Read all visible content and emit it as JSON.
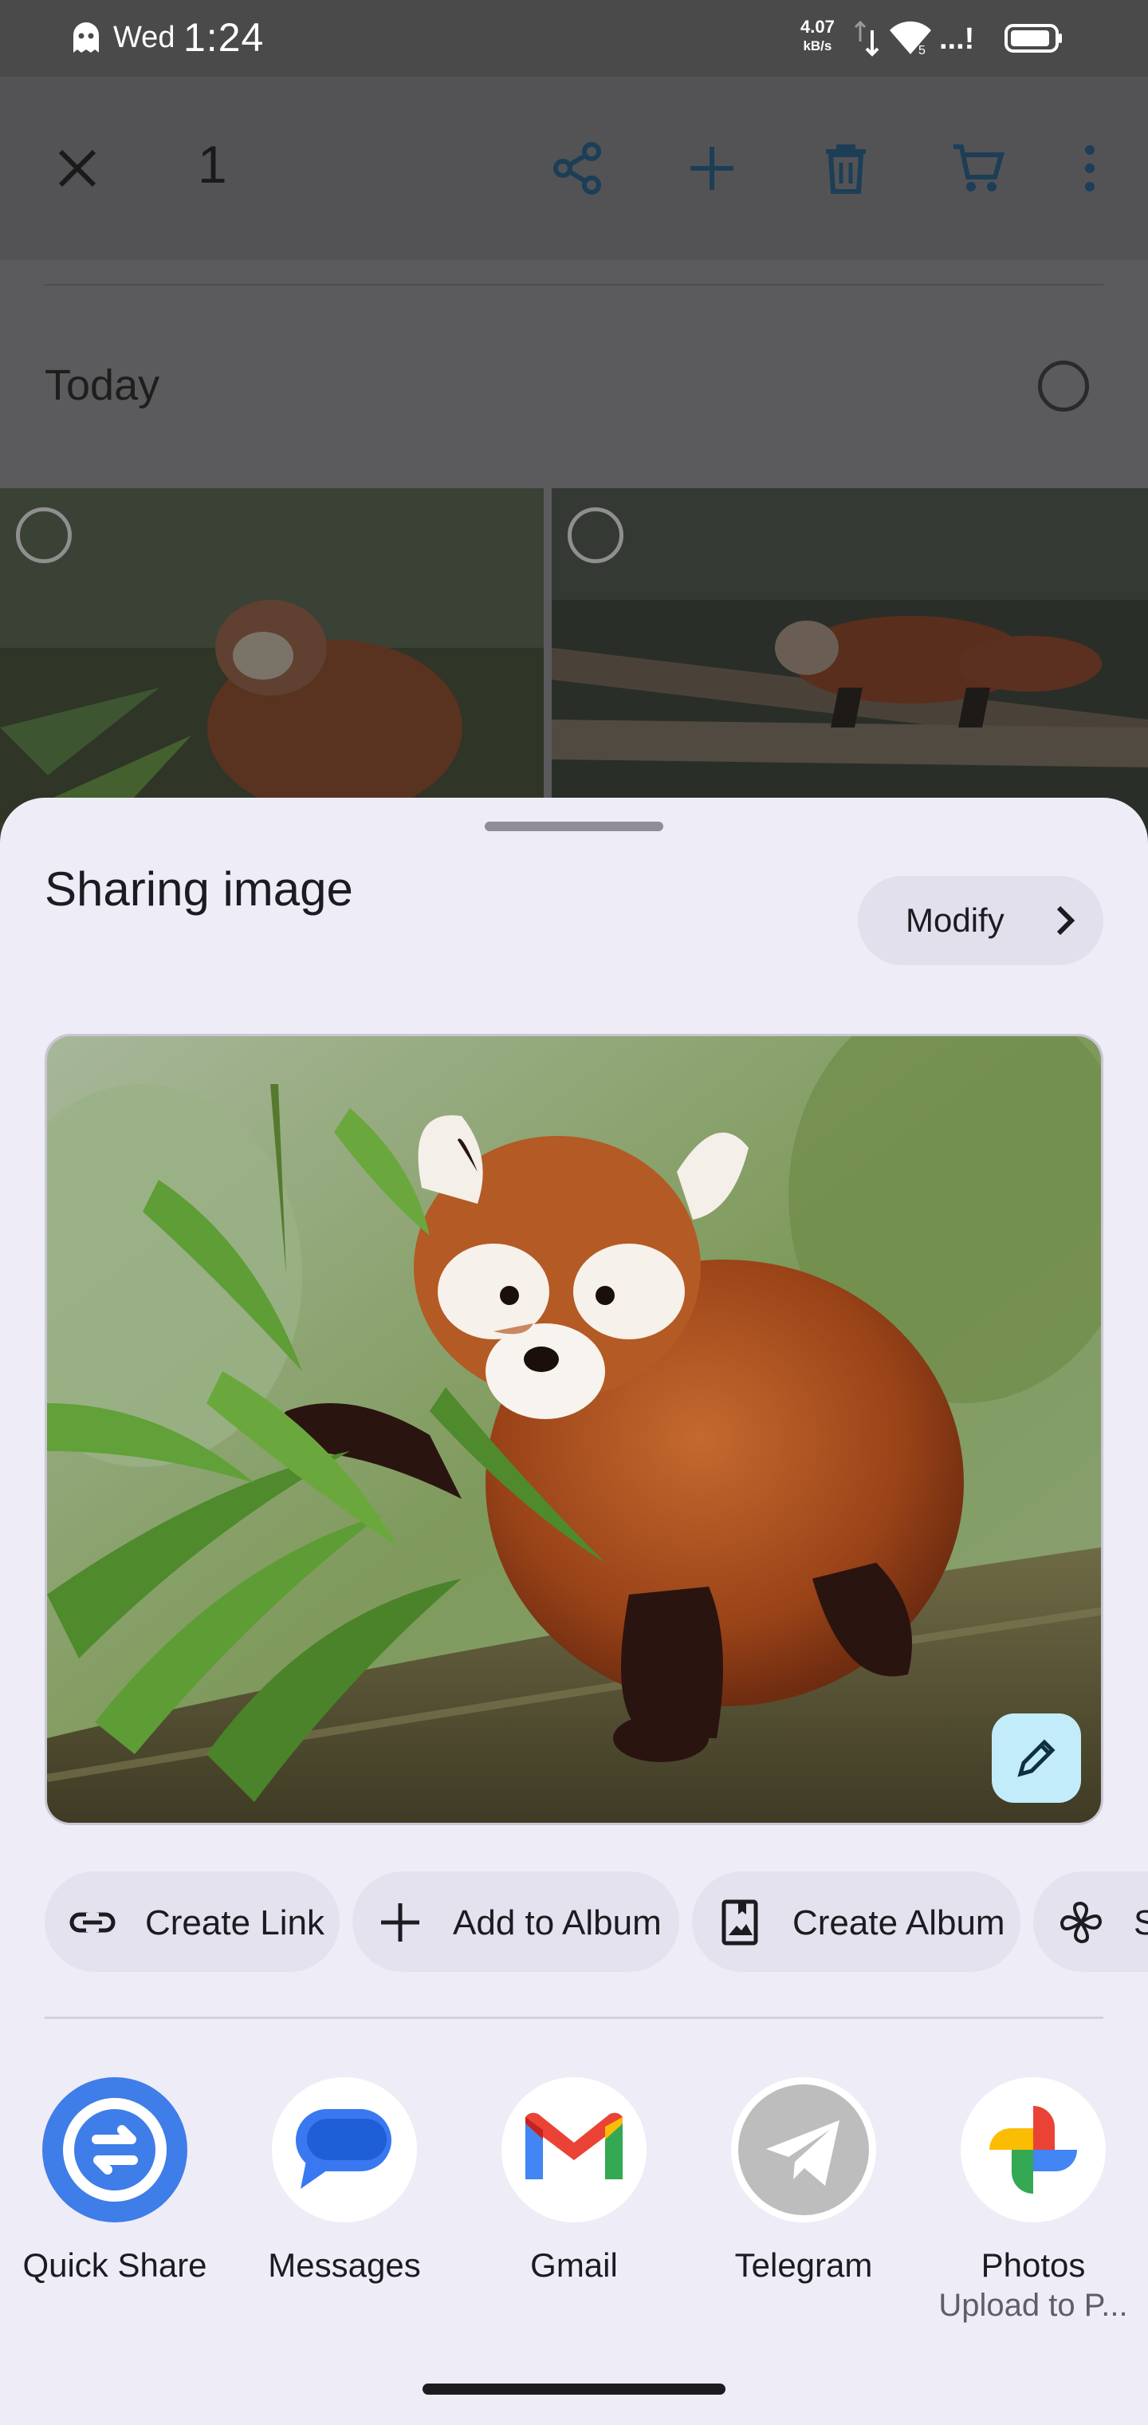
{
  "status_bar": {
    "day": "Wed",
    "time": "1:24",
    "net_speed": "4.07",
    "net_speed_unit": "kB/s",
    "signal_text": "...!"
  },
  "toolbar": {
    "selected_count": "1",
    "icons": [
      "close-icon",
      "share-icon",
      "add-icon",
      "delete-icon",
      "cart-icon",
      "more-vert-icon"
    ]
  },
  "gallery": {
    "section_title": "Today"
  },
  "share_sheet": {
    "title": "Sharing image",
    "modify_label": "Modify",
    "actions": [
      {
        "label": "Create Link",
        "icon": "link-icon"
      },
      {
        "label": "Add to Album",
        "icon": "plus-icon"
      },
      {
        "label": "Create Album",
        "icon": "album-icon"
      },
      {
        "label": "S",
        "icon": "pinwheel-icon"
      }
    ],
    "targets": [
      {
        "label": "Quick Share",
        "sublabel": "",
        "icon": "quick-share-icon"
      },
      {
        "label": "Messages",
        "sublabel": "",
        "icon": "messages-icon"
      },
      {
        "label": "Gmail",
        "sublabel": "",
        "icon": "gmail-icon"
      },
      {
        "label": "Telegram",
        "sublabel": "",
        "icon": "telegram-icon"
      },
      {
        "label": "Photos",
        "sublabel": "Upload to P...",
        "icon": "photos-icon"
      }
    ]
  },
  "colors": {
    "sheet_bg": "#eeecf7",
    "chip_bg": "#e4e2ee",
    "quick_share_blue": "#3f7de8",
    "edit_fab": "#c3ecfa",
    "scrim": "#5b5b5d"
  }
}
